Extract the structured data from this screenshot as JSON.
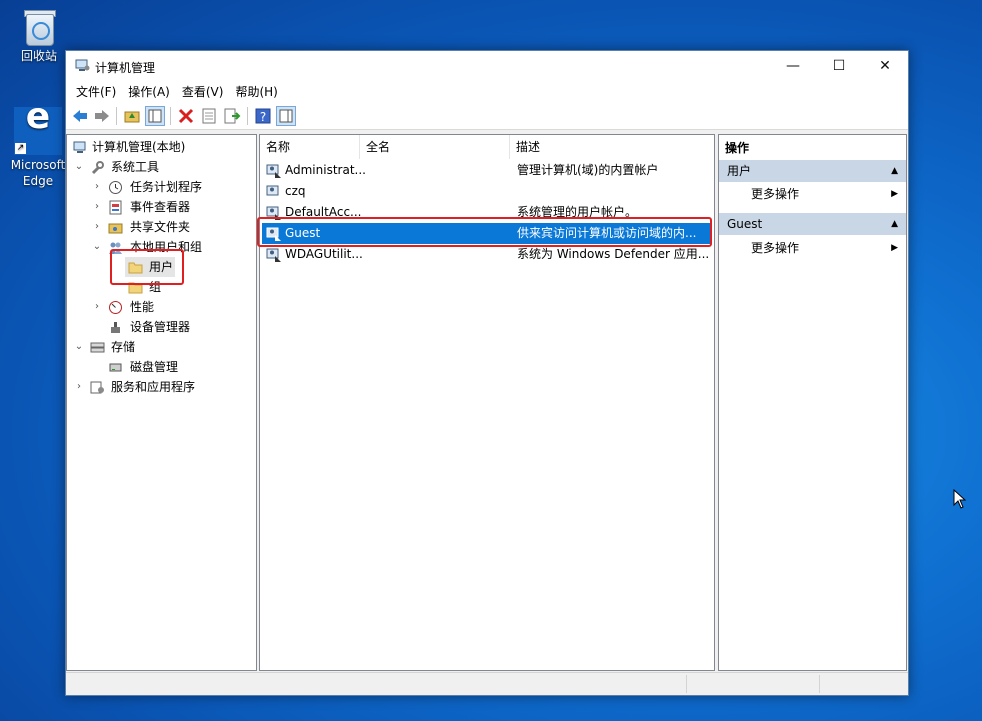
{
  "desktop": {
    "recycle_bin_label": "回收站",
    "edge_label_line1": "Microsoft",
    "edge_label_line2": "Edge"
  },
  "window": {
    "title": "计算机管理",
    "controls": {
      "minimize": "—",
      "maximize": "☐",
      "close": "✕"
    }
  },
  "menu": [
    "文件(F)",
    "操作(A)",
    "查看(V)",
    "帮助(H)"
  ],
  "toolbar_icons": [
    "back-arrow-icon",
    "forward-arrow-icon",
    "up-folder-icon",
    "show-hide-tree-icon",
    "delete-icon",
    "properties-icon",
    "export-list-icon",
    "help-icon",
    "show-hide-action-pane-icon"
  ],
  "tree": {
    "root": "计算机管理(本地)",
    "system_tools": "系统工具",
    "task_scheduler": "任务计划程序",
    "event_viewer": "事件查看器",
    "shared_folders": "共享文件夹",
    "local_users_groups": "本地用户和组",
    "users": "用户",
    "groups": "组",
    "performance": "性能",
    "device_manager": "设备管理器",
    "storage": "存储",
    "disk_management": "磁盘管理",
    "services_apps": "服务和应用程序"
  },
  "list": {
    "columns": [
      "名称",
      "全名",
      "描述"
    ],
    "rows": [
      {
        "name": "Administrat...",
        "fullname": "",
        "description": "管理计算机(域)的内置帐户"
      },
      {
        "name": "czq",
        "fullname": "",
        "description": ""
      },
      {
        "name": "DefaultAcc...",
        "fullname": "",
        "description": "系统管理的用户帐户。"
      },
      {
        "name": "Guest",
        "fullname": "",
        "description": "供来宾访问计算机或访问域的内..."
      },
      {
        "name": "WDAGUtilit...",
        "fullname": "",
        "description": "系统为 Windows Defender 应用..."
      }
    ],
    "selected_row": "Guest"
  },
  "actions": {
    "header": "操作",
    "group1": "用户",
    "group1_more": "更多操作",
    "group2": "Guest",
    "group2_more": "更多操作"
  },
  "colors": {
    "selection": "#0a78d7",
    "action_group_bg": "#c9d6e6",
    "highlight_box": "#e02020"
  }
}
